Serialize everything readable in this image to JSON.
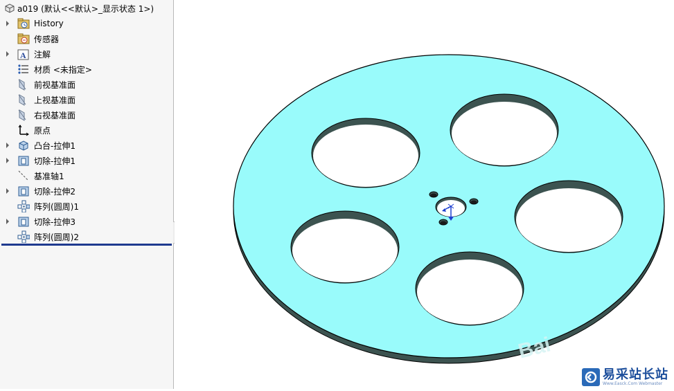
{
  "feature_tree": {
    "root": "a019  (默认<<默认>_显示状态 1>)",
    "items": [
      {
        "label": "History",
        "icon": "history-folder-icon",
        "expandable": true
      },
      {
        "label": "传感器",
        "icon": "sensor-icon",
        "expandable": false
      },
      {
        "label": "注解",
        "icon": "annotation-icon",
        "expandable": true
      },
      {
        "label": "材质 <未指定>",
        "icon": "material-icon",
        "expandable": false
      },
      {
        "label": "前视基准面",
        "icon": "plane-icon",
        "expandable": false
      },
      {
        "label": "上视基准面",
        "icon": "plane-icon",
        "expandable": false
      },
      {
        "label": "右视基准面",
        "icon": "plane-icon",
        "expandable": false
      },
      {
        "label": "原点",
        "icon": "origin-icon",
        "expandable": false
      },
      {
        "label": "凸台-拉伸1",
        "icon": "boss-extrude-icon",
        "expandable": true
      },
      {
        "label": "切除-拉伸1",
        "icon": "cut-extrude-icon",
        "expandable": true
      },
      {
        "label": "基准轴1",
        "icon": "axis-icon",
        "expandable": false
      },
      {
        "label": "切除-拉伸2",
        "icon": "cut-extrude-icon",
        "expandable": true
      },
      {
        "label": "阵列(圆周)1",
        "icon": "circular-pattern-icon",
        "expandable": false
      },
      {
        "label": "切除-拉伸3",
        "icon": "cut-extrude-icon",
        "expandable": true
      },
      {
        "label": "阵列(圆周)2",
        "icon": "circular-pattern-icon",
        "expandable": false
      }
    ]
  },
  "viewport": {
    "model_color": "#99fbfb",
    "edge_color": "#000000",
    "hole_fill": "#ffffff",
    "side_color": "#3c5350"
  },
  "watermark": {
    "text": "易采站长站",
    "subtext": "Www.Easck.Com Webmaster",
    "baidu_text": "Bai"
  }
}
